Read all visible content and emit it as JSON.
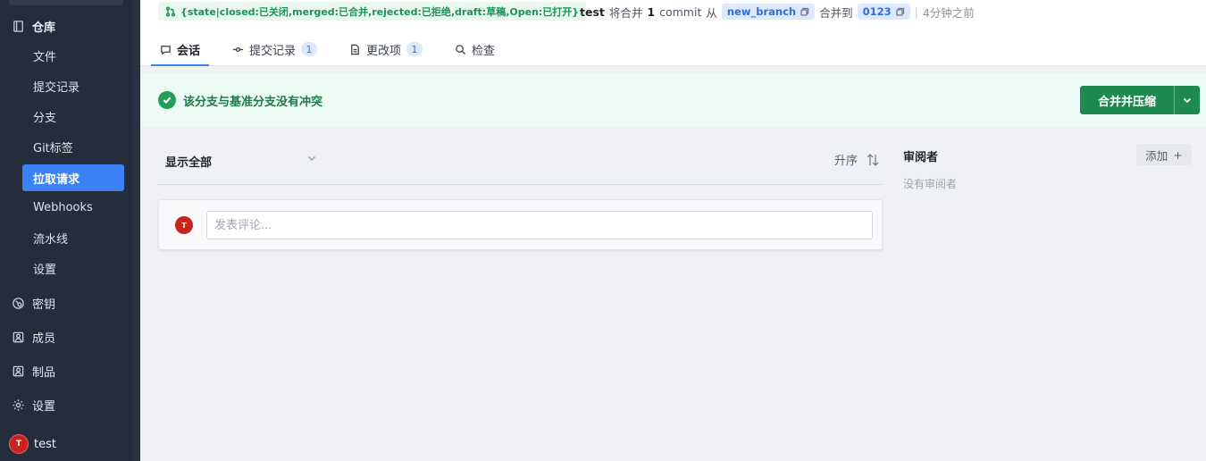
{
  "sidebar": {
    "section_title": "仓库",
    "items": [
      {
        "label": "文件",
        "active": false
      },
      {
        "label": "提交记录",
        "active": false
      },
      {
        "label": "分支",
        "active": false
      },
      {
        "label": "Git标签",
        "active": false
      },
      {
        "label": "拉取请求",
        "active": true
      },
      {
        "label": "Webhooks",
        "active": false
      },
      {
        "label": "流水线",
        "active": false
      },
      {
        "label": "设置",
        "active": false
      }
    ],
    "groups": [
      {
        "label": "密钥",
        "icon": "key-icon"
      },
      {
        "label": "成员",
        "icon": "members-icon"
      },
      {
        "label": "制品",
        "icon": "artifacts-icon"
      },
      {
        "label": "设置",
        "icon": "gear-icon"
      }
    ],
    "user": {
      "name": "test",
      "avatar_initial": "T",
      "avatar_color": "#c8231c"
    }
  },
  "header": {
    "state_badge": "{state|closed:已关闭,merged:已合并,rejected:已拒绝,draft:草稿,Open:已打开}",
    "author": "test",
    "action_text": "将合并",
    "commit_count": "1",
    "commit_word": "commit",
    "from_text": "从",
    "source_branch": "new_branch",
    "into_text": "合并到",
    "target_branch": "0123",
    "separator": "|",
    "time_ago": "4分钟之前",
    "tabs": [
      {
        "label": "会话",
        "count": null,
        "active": true,
        "icon": "chat-icon"
      },
      {
        "label": "提交记录",
        "count": "1",
        "active": false,
        "icon": "commit-icon"
      },
      {
        "label": "更改项",
        "count": "1",
        "active": false,
        "icon": "file-icon"
      },
      {
        "label": "检查",
        "count": null,
        "active": false,
        "icon": "search-icon"
      }
    ]
  },
  "banner": {
    "message": "该分支与基准分支没有冲突",
    "merge_button_label": "合并并压缩",
    "status_color": "#20a05a"
  },
  "activity": {
    "filter_label": "显示全部",
    "sort_label": "升序",
    "comment_placeholder": "发表评论...",
    "comment_avatar_initial": "T"
  },
  "reviewers": {
    "title": "审阅者",
    "add_label": "添加",
    "add_symbol": "+",
    "empty_text": "没有审阅者"
  }
}
